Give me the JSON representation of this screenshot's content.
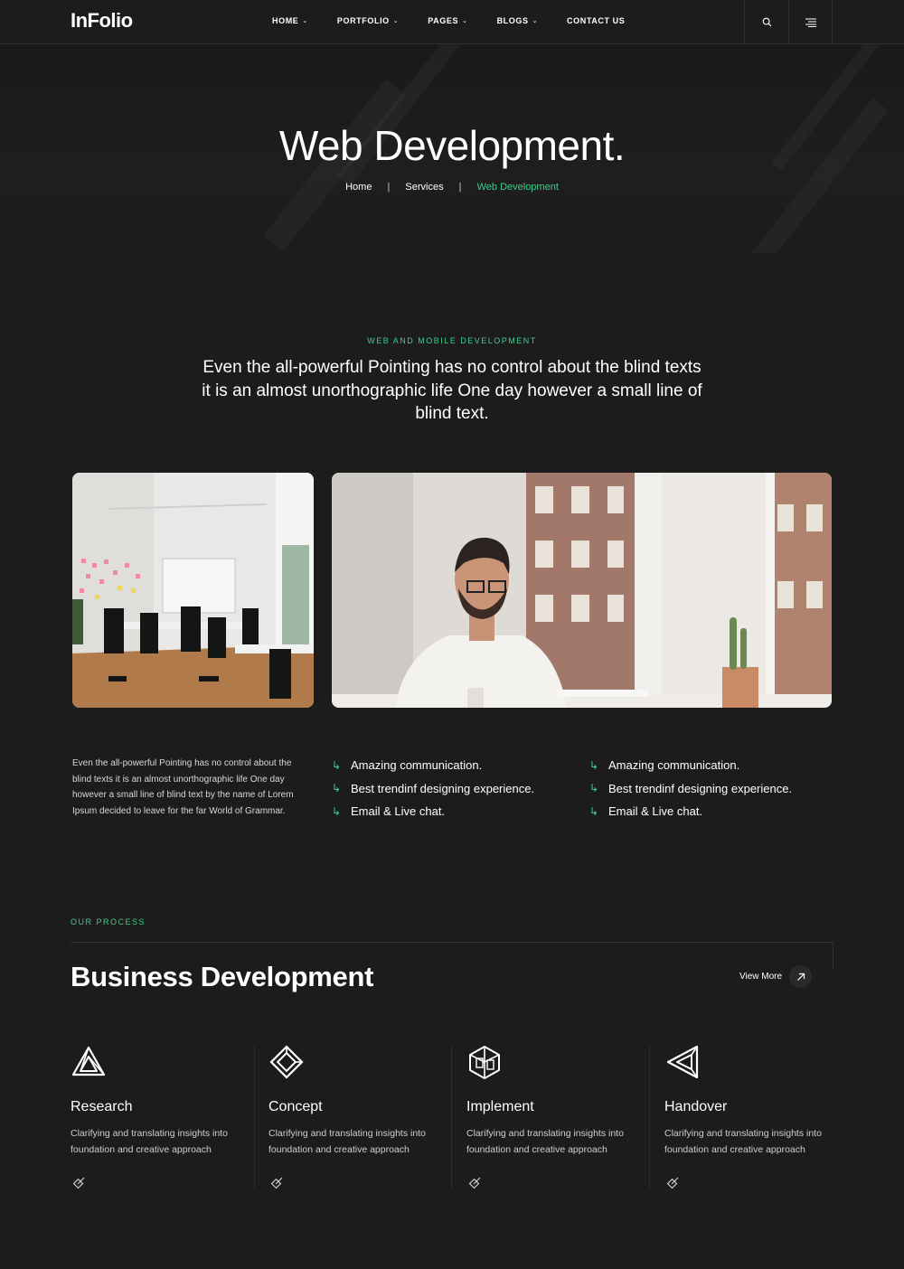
{
  "brand": {
    "name": "InFolio",
    "accent": "#3ecf8e",
    "background": "#1c1c1c"
  },
  "nav": {
    "items": [
      {
        "label": "HOME"
      },
      {
        "label": "PORTFOLIO"
      },
      {
        "label": "PAGES"
      },
      {
        "label": "BLOGS"
      },
      {
        "label": "CONTACT US"
      }
    ],
    "search_icon": "search-icon",
    "menu_icon": "hamburger-menu-icon"
  },
  "hero": {
    "title": "Web Development.",
    "breadcrumb": {
      "home": "Home",
      "separator": "|",
      "services": "Services",
      "current": "Web Development"
    }
  },
  "intro": {
    "eyebrow": "WEB AND MOBILE DEVELOPMENT",
    "text": "Even the all-powerful Pointing has no control about the blind texts it is an almost unorthographic life One day however a small line of blind text."
  },
  "details": {
    "paragraph": "Even the all-powerful Pointing has no control about the blind texts it is an almost unorthographic life One day however a small line of blind text by the name of Lorem Ipsum decided to leave for the far World of Grammar.",
    "features_col1": [
      "Amazing communication.",
      "Best trendinf designing experience.",
      "Email & Live chat."
    ],
    "features_col2": [
      "Amazing communication.",
      "Best trendinf designing experience.",
      "Email & Live chat."
    ]
  },
  "process": {
    "eyebrow": "OUR PROCESS",
    "title_bold": "Business",
    "title_light": "Development",
    "view_more": "View More",
    "steps": [
      {
        "title": "Research",
        "desc": "Clarifying and translating insights into foundation and creative approach",
        "icon": "impossible-triangle-icon"
      },
      {
        "title": "Concept",
        "desc": "Clarifying and translating insights into foundation and creative approach",
        "icon": "diamond-frame-icon"
      },
      {
        "title": "Implement",
        "desc": "Clarifying and translating insights into foundation and creative approach",
        "icon": "interlocking-cube-icon"
      },
      {
        "title": "Handover",
        "desc": "Clarifying and translating insights into foundation and creative approach",
        "icon": "impossible-arrow-icon"
      }
    ]
  }
}
